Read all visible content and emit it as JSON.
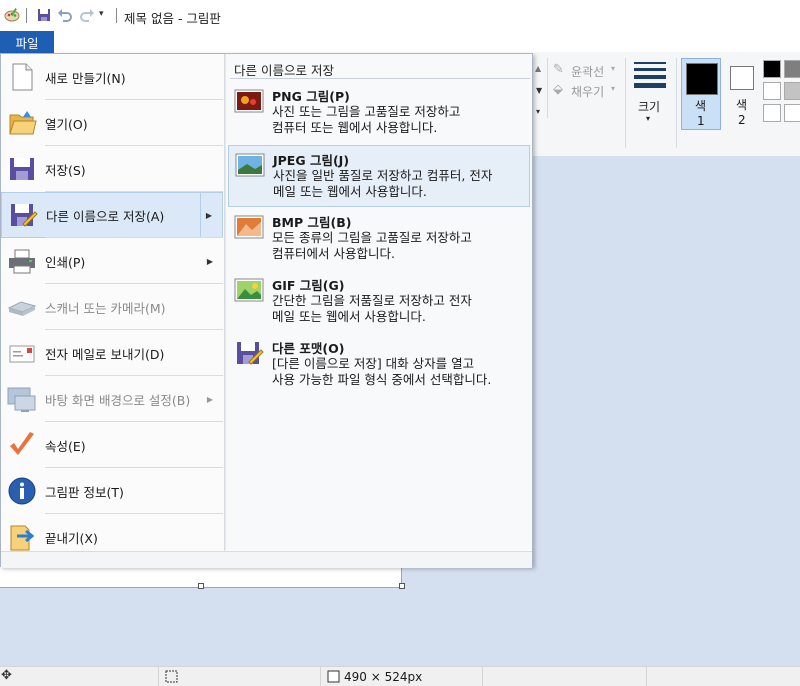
{
  "window": {
    "title": "제목 없음 - 그림판"
  },
  "file_tab": {
    "label": "파일"
  },
  "menu": {
    "items": [
      {
        "label": "새로 만들기(N)",
        "icon": "new-file-icon",
        "disabled": false,
        "submenu": false
      },
      {
        "label": "열기(O)",
        "icon": "open-folder-icon",
        "disabled": false,
        "submenu": false
      },
      {
        "label": "저장(S)",
        "icon": "save-icon",
        "disabled": false,
        "submenu": false
      },
      {
        "label": "다른 이름으로 저장(A)",
        "icon": "save-as-icon",
        "disabled": false,
        "submenu": true,
        "selected": true
      },
      {
        "label": "인쇄(P)",
        "icon": "printer-icon",
        "disabled": false,
        "submenu": true
      },
      {
        "label": "스캐너 또는 카메라(M)",
        "icon": "scanner-icon",
        "disabled": true,
        "submenu": false
      },
      {
        "label": "전자 메일로 보내기(D)",
        "icon": "email-icon",
        "disabled": false,
        "submenu": false
      },
      {
        "label": "바탕 화면 배경으로 설정(B)",
        "icon": "desktop-background-icon",
        "disabled": true,
        "submenu": true
      },
      {
        "label": "속성(E)",
        "icon": "checkmark-icon",
        "disabled": false,
        "submenu": false
      },
      {
        "label": "그림판 정보(T)",
        "icon": "info-icon",
        "disabled": false,
        "submenu": false
      },
      {
        "label": "끝내기(X)",
        "icon": "exit-icon",
        "disabled": false,
        "submenu": false
      }
    ]
  },
  "save_as_panel": {
    "title": "다른 이름으로 저장",
    "options": [
      {
        "name": "PNG 그림(P)",
        "line1": "사진 또는 그림을 고품질로 저장하고",
        "line2": "컴퓨터 또는 웹에서 사용합니다.",
        "icon": "png-image-icon"
      },
      {
        "name": "JPEG 그림(J)",
        "line1": "사진을 일반 품질로 저장하고 컴퓨터, 전자",
        "line2": "메일 또는 웹에서 사용합니다.",
        "icon": "jpeg-image-icon",
        "selected": true
      },
      {
        "name": "BMP 그림(B)",
        "line1": "모든 종류의 그림을 고품질로 저장하고",
        "line2": "컴퓨터에서 사용합니다.",
        "icon": "bmp-image-icon"
      },
      {
        "name": "GIF 그림(G)",
        "line1": "간단한 그림을 저품질로 저장하고 전자",
        "line2": "메일 또는 웹에서 사용합니다.",
        "icon": "gif-image-icon"
      },
      {
        "name": "다른 포맷(O)",
        "line1": "[다른 이름으로 저장] 대화 상자를 열고",
        "line2": "사용 가능한 파일 형식 중에서 선택합니다.",
        "icon": "other-format-icon"
      }
    ]
  },
  "ribbon": {
    "outline_label": "윤곽선",
    "fill_label": "채우기",
    "size_label": "크기",
    "color1_label": "색",
    "color1_num": "1",
    "color2_label": "색",
    "color2_num": "2"
  },
  "status": {
    "dimensions": "490 × 524px"
  },
  "colors": {
    "accent": "#1e5fb4",
    "canvas_bg": "#d4dfef"
  }
}
